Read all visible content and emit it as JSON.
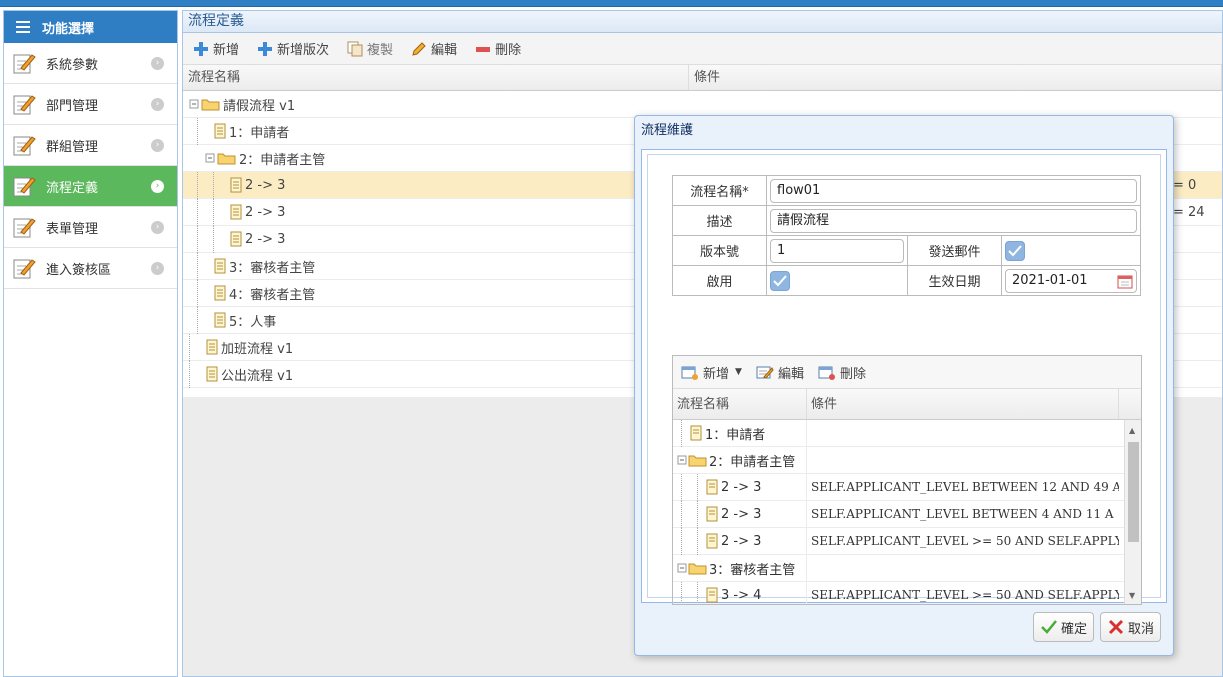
{
  "sidebar": {
    "title": "功能選擇",
    "items": [
      {
        "label": "系統參數",
        "active": false
      },
      {
        "label": "部門管理",
        "active": false
      },
      {
        "label": "群組管理",
        "active": false
      },
      {
        "label": "流程定義",
        "active": true
      },
      {
        "label": "表單管理",
        "active": false
      },
      {
        "label": "進入簽核區",
        "active": false
      }
    ]
  },
  "main": {
    "title": "流程定義",
    "toolbar": {
      "add": "新增",
      "add_version": "新增版次",
      "copy": "複製",
      "edit": "編輯",
      "delete": "刪除"
    },
    "columns": {
      "name": "流程名稱",
      "condition": "條件"
    },
    "rows": [
      {
        "label": "請假流程 v1",
        "cond": ""
      },
      {
        "label": "1：申請者",
        "cond": ""
      },
      {
        "label": "2：申請者主管",
        "cond": ""
      },
      {
        "label": "2 -> 3",
        "cond": "= 0"
      },
      {
        "label": "2 -> 3",
        "cond": "= 24"
      },
      {
        "label": "2 -> 3",
        "cond": ""
      },
      {
        "label": "3：審核者主管",
        "cond": ""
      },
      {
        "label": "4：審核者主管",
        "cond": ""
      },
      {
        "label": "5：人事",
        "cond": ""
      },
      {
        "label": "加班流程 v1",
        "cond": ""
      },
      {
        "label": "公出流程 v1",
        "cond": ""
      }
    ]
  },
  "modal": {
    "title": "流程維護",
    "form": {
      "name_label": "流程名稱*",
      "name_value": "flow01",
      "desc_label": "描述",
      "desc_value": "請假流程",
      "version_label": "版本號",
      "version_value": "1",
      "send_mail_label": "發送郵件",
      "enabled_label": "啟用",
      "effective_date_label": "生效日期",
      "effective_date_value": "2021-01-01"
    },
    "subgrid": {
      "toolbar": {
        "add": "新增",
        "edit": "編輯",
        "delete": "刪除"
      },
      "columns": {
        "name": "流程名稱",
        "condition": "條件"
      },
      "rows": [
        {
          "label": "1：申請者",
          "cond": ""
        },
        {
          "label": "2：申請者主管",
          "cond": ""
        },
        {
          "label": "2 -> 3",
          "cond": "SELF.APPLICANT_LEVEL BETWEEN 12 AND 49 A"
        },
        {
          "label": "2 -> 3",
          "cond": "SELF.APPLICANT_LEVEL BETWEEN 4 AND 11 A"
        },
        {
          "label": "2 -> 3",
          "cond": "SELF.APPLICANT_LEVEL >= 50 AND SELF.APPLY"
        },
        {
          "label": "3：審核者主管",
          "cond": ""
        },
        {
          "label": "3 -> 4",
          "cond": "SELF.APPLICANT_LEVEL >= 50 AND SELF.APPLY"
        }
      ]
    },
    "footer": {
      "ok": "確定",
      "cancel": "取消"
    }
  },
  "colors": {
    "accent": "#2f7ec4",
    "active": "#5cb85c",
    "selected_row": "#fbecc4"
  }
}
